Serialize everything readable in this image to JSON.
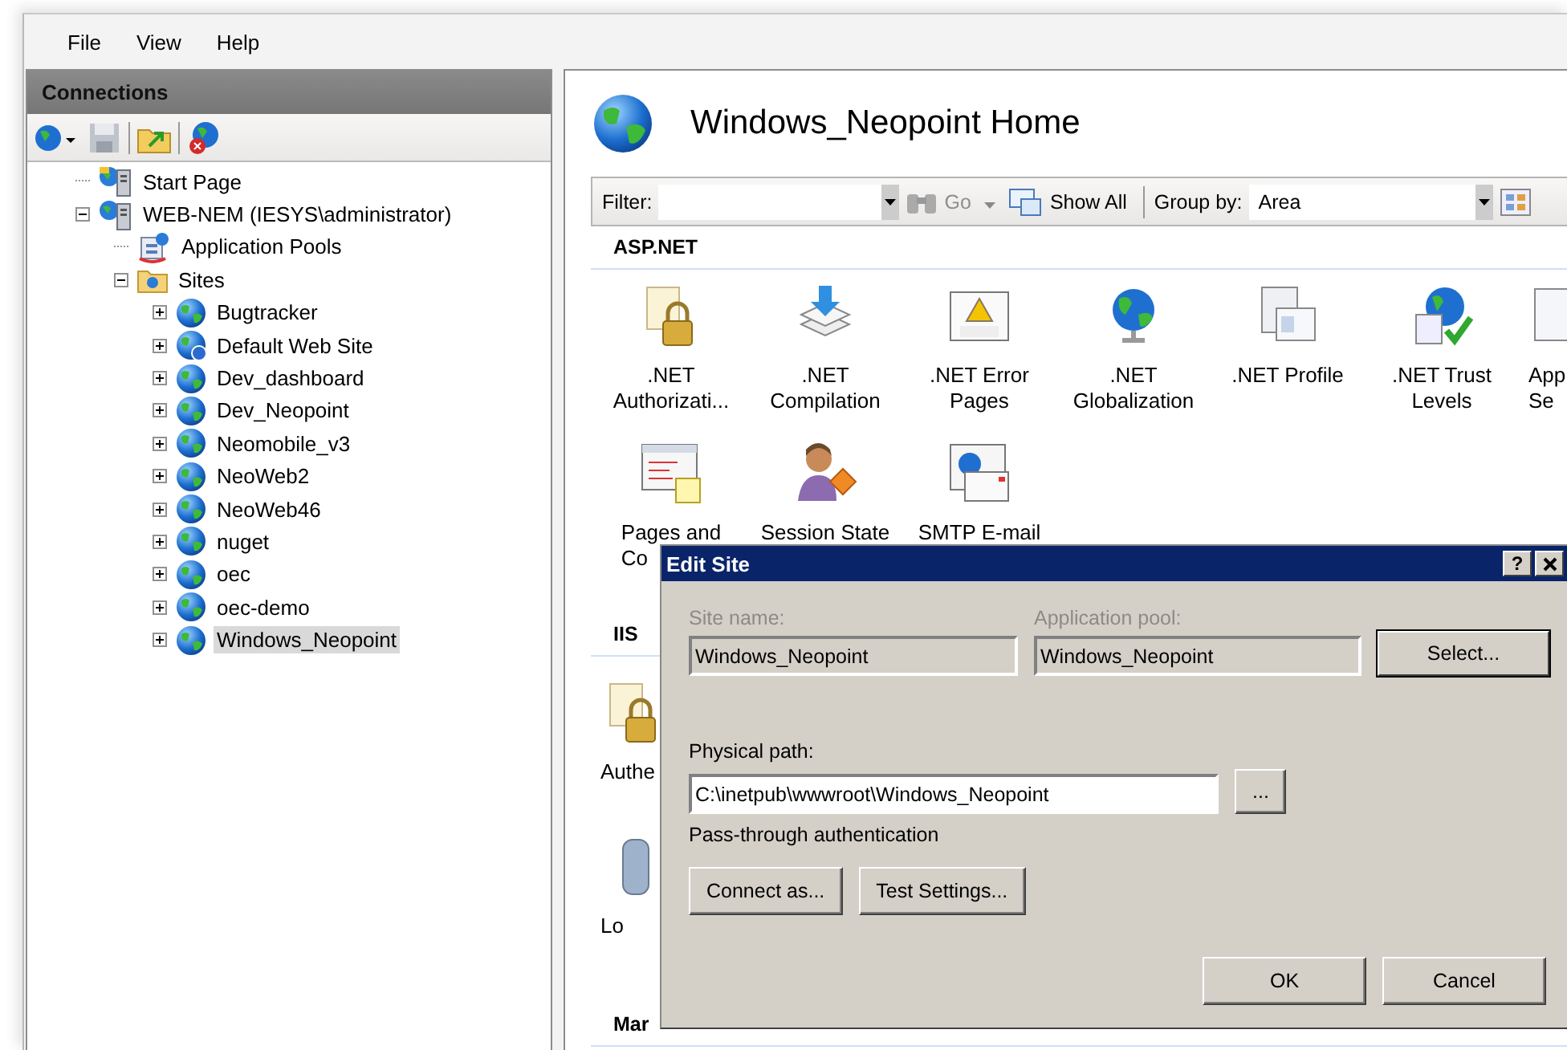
{
  "menu": [
    {
      "label": "File"
    },
    {
      "label": "View"
    },
    {
      "label": "Help"
    }
  ],
  "connections": {
    "title": "Connections",
    "tree": [
      {
        "label": "Start Page",
        "kind": "start-page",
        "selected": false
      },
      {
        "label": "WEB-NEM (IESYS\\administrator)",
        "kind": "server",
        "expanded": true,
        "selected": false,
        "children": [
          {
            "label": "Application Pools",
            "kind": "app-pools",
            "selected": false
          },
          {
            "label": "Sites",
            "kind": "sites",
            "expanded": true,
            "selected": false,
            "children": [
              {
                "label": "Bugtracker",
                "kind": "site",
                "expanded": false,
                "selected": false
              },
              {
                "label": "Default Web Site",
                "kind": "site-default",
                "expanded": false,
                "selected": false
              },
              {
                "label": "Dev_dashboard",
                "kind": "site",
                "expanded": false,
                "selected": false
              },
              {
                "label": "Dev_Neopoint",
                "kind": "site",
                "expanded": false,
                "selected": false
              },
              {
                "label": "Neomobile_v3",
                "kind": "site",
                "expanded": false,
                "selected": false
              },
              {
                "label": "NeoWeb2",
                "kind": "site",
                "expanded": false,
                "selected": false
              },
              {
                "label": "NeoWeb46",
                "kind": "site",
                "expanded": false,
                "selected": false
              },
              {
                "label": "nuget",
                "kind": "site",
                "expanded": false,
                "selected": false
              },
              {
                "label": "oec",
                "kind": "site",
                "expanded": false,
                "selected": false
              },
              {
                "label": "oec-demo",
                "kind": "site",
                "expanded": false,
                "selected": false
              },
              {
                "label": "Windows_Neopoint",
                "kind": "site",
                "expanded": false,
                "selected": true
              }
            ]
          }
        ]
      }
    ]
  },
  "home": {
    "title": "Windows_Neopoint Home",
    "filter": {
      "label": "Filter:",
      "go": "Go",
      "go_disabled": true,
      "show_all": "Show All",
      "group_by_label": "Group by:",
      "group_by_value": "Area"
    },
    "groups": [
      {
        "title": "ASP.NET",
        "features": [
          {
            "kind": "authorization",
            "lines": [
              ".NET",
              "Authorizati..."
            ]
          },
          {
            "kind": "compilation",
            "lines": [
              ".NET",
              "Compilation"
            ]
          },
          {
            "kind": "error-pages",
            "lines": [
              ".NET Error",
              "Pages"
            ]
          },
          {
            "kind": "globalization",
            "lines": [
              ".NET",
              "Globalization"
            ]
          },
          {
            "kind": "profile",
            "lines": [
              ".NET Profile"
            ]
          },
          {
            "kind": "trust",
            "lines": [
              ".NET Trust",
              "Levels"
            ]
          },
          {
            "kind": "app-settings",
            "lines": [
              "App",
              "Se"
            ]
          },
          {
            "kind": "pages",
            "lines": [
              "Pages and",
              "Co"
            ]
          },
          {
            "kind": "session",
            "lines": [
              "Session State"
            ]
          },
          {
            "kind": "smtp",
            "lines": [
              "SMTP E-mail"
            ]
          }
        ]
      },
      {
        "title": "IIS",
        "features": [
          {
            "kind": "authentication",
            "lines": [
              "Authe"
            ]
          },
          {
            "kind": "logging",
            "lines": [
              "Lo"
            ]
          }
        ]
      },
      {
        "title": "Mar"
      }
    ]
  },
  "dialog": {
    "title": "Edit Site",
    "help": "?",
    "site_name": {
      "label": "Site name:",
      "value": "Windows_Neopoint",
      "disabled": true
    },
    "app_pool": {
      "label": "Application pool:",
      "value": "Windows_Neopoint",
      "disabled": true
    },
    "select_button": {
      "label": "Select...",
      "default": true
    },
    "physical_path": {
      "label": "Physical path:",
      "value": "C:\\inetpub\\wwwroot\\Windows_Neopoint"
    },
    "browse_button": {
      "label": "...",
      "default": false
    },
    "pass_through": "Pass-through authentication",
    "buttons": [
      {
        "label": "Connect as...",
        "default": false
      },
      {
        "label": "Test Settings...",
        "default": false
      }
    ],
    "footer": [
      {
        "label": "OK",
        "default": false
      },
      {
        "label": "Cancel",
        "default": false
      }
    ]
  }
}
